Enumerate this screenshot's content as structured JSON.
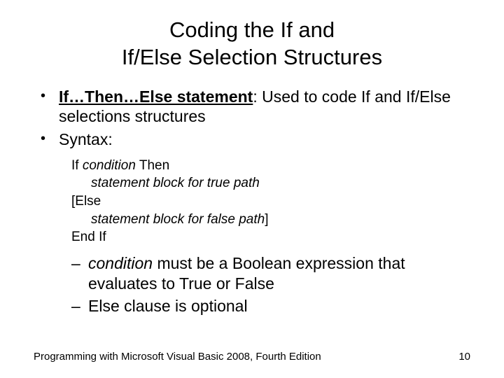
{
  "title_line1": "Coding the If and",
  "title_line2": "If/Else Selection Structures",
  "bullets": {
    "b1_bold": "If…Then…Else statement",
    "b1_rest": ": Used to code If and If/Else selections structures",
    "b2": "Syntax:"
  },
  "syntax": {
    "l1a": "If ",
    "l1b": "condition",
    "l1c": " Then",
    "l2": "statement block for true path",
    "l3": "[Else",
    "l4a": "statement block for false path",
    "l4b": "]",
    "l5": "End If"
  },
  "sub": {
    "s1_em": "condition",
    "s1_rest": " must be a Boolean expression that evaluates to True or False",
    "s2": "Else clause is optional"
  },
  "footer": {
    "left": "Programming with Microsoft Visual Basic 2008, Fourth Edition",
    "right": "10"
  }
}
